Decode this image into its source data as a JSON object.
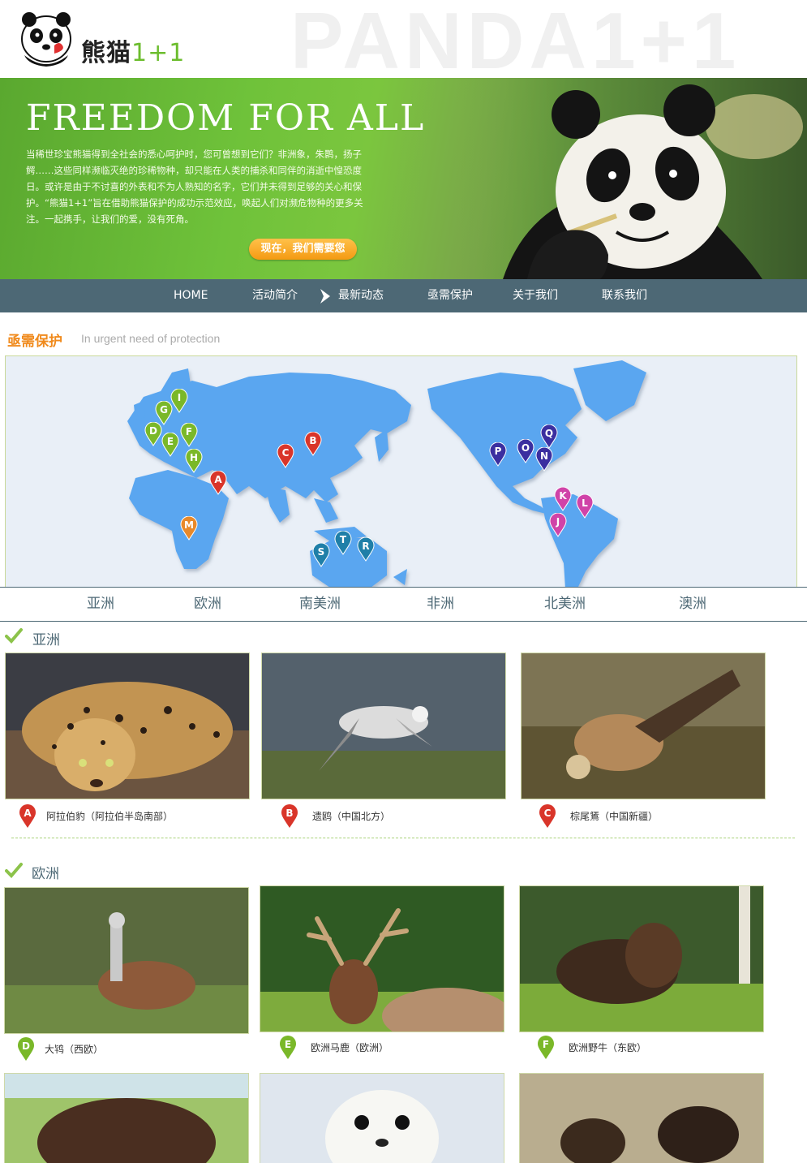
{
  "header": {
    "logo_cn": "熊猫",
    "logo_num": "1+1",
    "watermark": "PANDA1+1"
  },
  "banner": {
    "title": "FREEDOM FOR ALL",
    "text": "当稀世珍宝熊猫得到全社会的悉心呵护时，您可曾想到它们？非洲象，朱鹮，扬子鳄……这些同样濒临灭绝的珍稀物种，却只能在人类的捕杀和同伴的消逝中惶恐度日。或许是由于不讨喜的外表和不为人熟知的名字，它们并未得到足够的关心和保护。“熊猫1+1”旨在借助熊猫保护的成功示范效应，唤起人们对濒危物种的更多关注。一起携手，让我们的爱，没有死角。",
    "cta": "现在，我们需要您"
  },
  "nav": {
    "items": [
      "HOME",
      "活动简介",
      "最新动态",
      "亟需保护",
      "关于我们",
      "联系我们"
    ],
    "active_index": 2
  },
  "section": {
    "title": "亟需保护",
    "subtitle": "In urgent need of protection"
  },
  "map": {
    "markers": [
      {
        "letter": "A",
        "color": "#d9352a"
      },
      {
        "letter": "B",
        "color": "#d9352a"
      },
      {
        "letter": "C",
        "color": "#d9352a"
      },
      {
        "letter": "D",
        "color": "#7ab829"
      },
      {
        "letter": "E",
        "color": "#7ab829"
      },
      {
        "letter": "F",
        "color": "#7ab829"
      },
      {
        "letter": "G",
        "color": "#7ab829"
      },
      {
        "letter": "H",
        "color": "#7ab829"
      },
      {
        "letter": "I",
        "color": "#7ab829"
      },
      {
        "letter": "J",
        "color": "#d043a8"
      },
      {
        "letter": "K",
        "color": "#d043a8"
      },
      {
        "letter": "L",
        "color": "#d043a8"
      },
      {
        "letter": "M",
        "color": "#e8892a"
      },
      {
        "letter": "N",
        "color": "#3b2fa0"
      },
      {
        "letter": "O",
        "color": "#3b2fa0"
      },
      {
        "letter": "P",
        "color": "#3b2fa0"
      },
      {
        "letter": "Q",
        "color": "#3b2fa0"
      },
      {
        "letter": "R",
        "color": "#1f7fa8"
      },
      {
        "letter": "S",
        "color": "#1f7fa8"
      },
      {
        "letter": "T",
        "color": "#1f7fa8"
      }
    ]
  },
  "continents": [
    "亚洲",
    "欧洲",
    "南美洲",
    "非洲",
    "北美洲",
    "澳洲"
  ],
  "groups": [
    {
      "title": "亚洲",
      "animals": [
        {
          "letter": "A",
          "color": "#d9352a",
          "caption": "阿拉伯豹（阿拉伯半岛南部）"
        },
        {
          "letter": "B",
          "color": "#d9352a",
          "caption": "遗鸥（中国北方）"
        },
        {
          "letter": "C",
          "color": "#d9352a",
          "caption": "棕尾鵟（中国新疆）"
        }
      ]
    },
    {
      "title": "欧洲",
      "animals": [
        {
          "letter": "D",
          "color": "#7ab829",
          "caption": "大鸨（西欧）"
        },
        {
          "letter": "E",
          "color": "#7ab829",
          "caption": "欧洲马鹿（欧洲）"
        },
        {
          "letter": "F",
          "color": "#7ab829",
          "caption": "欧洲野牛（东欧）"
        }
      ]
    }
  ],
  "colors": {
    "nav_bg": "#4d6875",
    "accent_orange": "#f08a1c",
    "map_land": "#5aa6f0"
  }
}
